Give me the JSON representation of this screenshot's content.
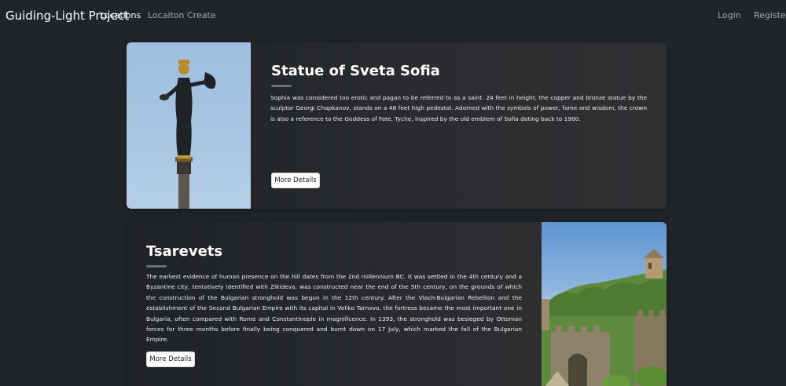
{
  "navbar": {
    "brand": "Guiding-Light Project",
    "links": [
      {
        "label": "Locations"
      },
      {
        "label": "Locaiton Create"
      }
    ],
    "auth": [
      {
        "label": "Login"
      },
      {
        "label": "Register"
      }
    ]
  },
  "locations": [
    {
      "title": "Statue of Sveta Sofia",
      "description": "Sophia was considered too erotic and pagan to be referred to as a saint. 24 feet in height, the copper and bronze statue by the sculptor Georgi Chapkanov, stands on a 48 feet high pedestal. Adorned with the symbols of power, fame and wisdom, the crown is also a reference to the Goddess of Fate, Tyche, inspired by the old emblem of Sofia dating back to 1900.",
      "button_label": "More Details"
    },
    {
      "title": "Tsarevets",
      "description": "The earliest evidence of human presence on the hill dates from the 2nd millennium BC. It was settled in the 4th century and a Byzantine city, tentatively identified with Zikideva, was constructed near the end of the 5th century, on the grounds of which the construction of the Bulgarian stronghold was begun in the 12th century. After the Vlach-Bulgarian Rebellion and the establishment of the Second Bulgarian Empire with its capital in Veliko Tarnovo, the fortress became the most important one in Bulgaria, often compared with Rome and Constantinople in magnificence. In 1393, the stronghold was besieged by Ottoman forces for three months before finally being conquered and burnt down on 17 July, which marked the fall of the Bulgarian Empire.",
      "button_label": "More Details"
    }
  ]
}
